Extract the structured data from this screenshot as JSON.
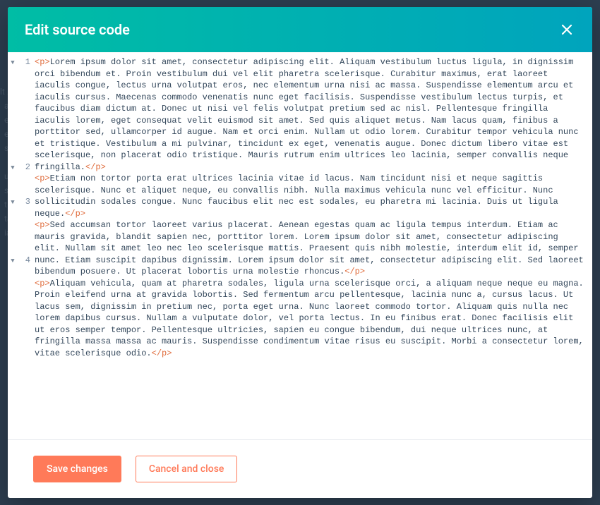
{
  "modal": {
    "title": "Edit source code"
  },
  "buttons": {
    "save": "Save changes",
    "cancel": "Cancel and close"
  },
  "code_lines": [
    {
      "n": 1,
      "open": "<p>",
      "text": "Lorem ipsum dolor sit amet, consectetur adipiscing elit. Aliquam vestibulum luctus ligula, in dignissim orci bibendum et. Proin vestibulum dui vel elit pharetra scelerisque. Curabitur maximus, erat laoreet iaculis congue, lectus urna volutpat eros, nec elementum urna nisi ac massa. Suspendisse elementum arcu et iaculis cursus. Maecenas commodo venenatis nunc eget facilisis. Suspendisse vestibulum lectus turpis, et faucibus diam dictum at. Donec ut nisi vel felis volutpat pretium sed ac nisl. Pellentesque fringilla iaculis lorem, eget consequat velit euismod sit amet. Sed quis aliquet metus. Nam lacus quam, finibus a porttitor sed, ullamcorper id augue. Nam et orci enim. Nullam ut odio lorem. Curabitur tempor vehicula nunc et tristique. Vestibulum a mi pulvinar, tincidunt ex eget, venenatis augue. Donec dictum libero vitae est scelerisque, non placerat odio tristique. Mauris rutrum enim ultrices leo lacinia, semper convallis neque fringilla.",
      "close": "</p>",
      "wrap_lines": 9
    },
    {
      "n": 2,
      "open": "<p>",
      "text": "Etiam non tortor porta erat ultrices lacinia vitae id lacus. Nam tincidunt nisi et neque sagittis scelerisque. Nunc et aliquet neque, eu convallis nibh. Nulla maximus vehicula nunc vel efficitur. Nunc sollicitudin sodales congue. Nunc faucibus elit nec est sodales, eu pharetra mi lacinia. Duis ut ligula neque.",
      "close": "</p>",
      "wrap_lines": 3
    },
    {
      "n": 3,
      "open": "<p>",
      "text": "Sed accumsan tortor laoreet varius placerat. Aenean egestas quam ac ligula tempus interdum. Etiam ac mauris gravida, blandit sapien nec, porttitor lorem. Lorem ipsum dolor sit amet, consectetur adipiscing elit. Nullam sit amet leo nec leo scelerisque mattis. Praesent quis nibh molestie, interdum elit id, semper nunc. Etiam suscipit dapibus dignissim. Lorem ipsum dolor sit amet, consectetur adipiscing elit. Sed laoreet bibendum posuere. Ut placerat lobortis urna molestie rhoncus.",
      "close": "</p>",
      "wrap_lines": 5
    },
    {
      "n": 4,
      "open": "<p>",
      "text": "Aliquam vehicula, quam at pharetra sodales, ligula urna scelerisque orci, a aliquam neque neque eu magna. Proin eleifend urna at gravida lobortis. Sed fermentum arcu pellentesque, lacinia nunc a, cursus lacus. Ut lacus sem, dignissim in pretium nec, porta eget urna. Nunc laoreet commodo tortor. Aliquam quis nulla nec lorem dapibus cursus. Nullam a vulputate dolor, vel porta lectus. In eu finibus erat. Donec facilisis elit ut eros semper tempor. Pellentesque ultricies, sapien eu congue bibendum, dui neque ultrices nunc, at fringilla massa massa ac mauris. Suspendisse condimentum vitae risus eu suscipit. Morbi a consectetur lorem, vitae scelerisque odio.",
      "close": "</p>",
      "wrap_lines": 6
    }
  ]
}
